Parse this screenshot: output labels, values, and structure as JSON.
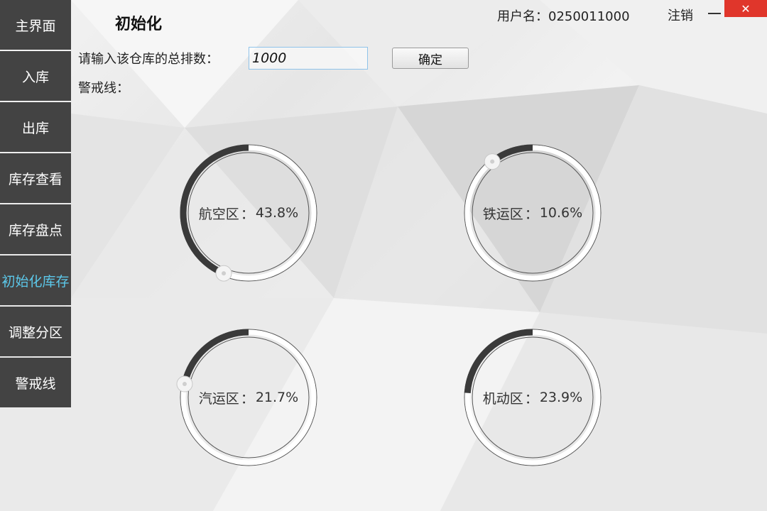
{
  "sidebar": {
    "items": [
      {
        "label": "主界面",
        "active": false
      },
      {
        "label": "入库",
        "active": false
      },
      {
        "label": "出库",
        "active": false
      },
      {
        "label": "库存查看",
        "active": false
      },
      {
        "label": "库存盘点",
        "active": false
      },
      {
        "label": "初始化库存",
        "active": true
      },
      {
        "label": "调整分区",
        "active": false
      },
      {
        "label": "警戒线",
        "active": false
      }
    ],
    "bg_color": "#434343",
    "active_color": "#5cc8ea"
  },
  "header": {
    "title": "初始化",
    "username": "用户名：0250011000",
    "logout": "注销",
    "close_color": "#e0362b"
  },
  "form": {
    "rows_label": "请输入该仓库的总排数：",
    "rows_value": "1000",
    "confirm_label": "确定",
    "warning_label": "警戒线：",
    "warning_value": ""
  },
  "zones": [
    {
      "name": "航空区",
      "percent_text": "43.8%",
      "value": 0.438
    },
    {
      "name": "铁运区",
      "percent_text": "10.6%",
      "value": 0.106
    },
    {
      "name": "汽运区",
      "percent_text": "21.7%",
      "value": 0.217
    },
    {
      "name": "机动区",
      "percent_text": "23.9%",
      "value": 0.239
    }
  ],
  "ring_colors": {
    "progress": "#3a3a3a",
    "track": "#ffffff"
  }
}
